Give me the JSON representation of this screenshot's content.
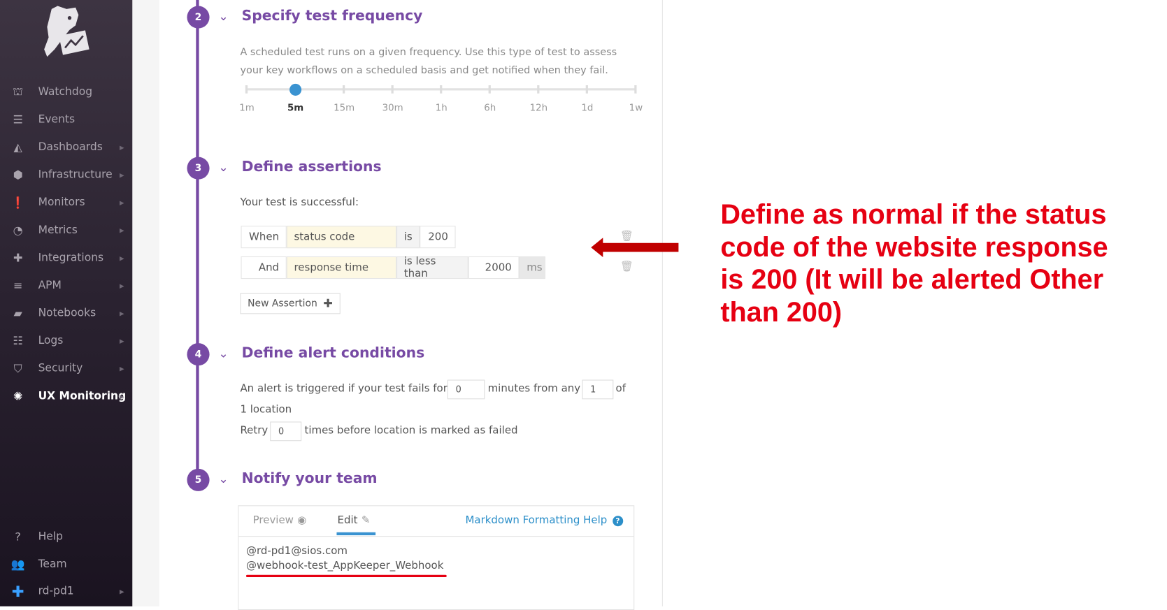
{
  "sidebar": {
    "items": [
      {
        "label": "Watchdog",
        "icon": "binoculars-icon",
        "glyph": "⛫",
        "arrow": false
      },
      {
        "label": "Events",
        "icon": "events-list-icon",
        "glyph": "☰",
        "arrow": false
      },
      {
        "label": "Dashboards",
        "icon": "area-chart-icon",
        "glyph": "◭",
        "arrow": true
      },
      {
        "label": "Infrastructure",
        "icon": "hexagons-icon",
        "glyph": "⬢",
        "arrow": true
      },
      {
        "label": "Monitors",
        "icon": "alert-icon",
        "glyph": "❗",
        "arrow": true
      },
      {
        "label": "Metrics",
        "icon": "gauge-icon",
        "glyph": "◔",
        "arrow": true
      },
      {
        "label": "Integrations",
        "icon": "puzzle-icon",
        "glyph": "✚",
        "arrow": true
      },
      {
        "label": "APM",
        "icon": "apm-icon",
        "glyph": "≡",
        "arrow": true
      },
      {
        "label": "Notebooks",
        "icon": "notebook-icon",
        "glyph": "▰",
        "arrow": true
      },
      {
        "label": "Logs",
        "icon": "logs-icon",
        "glyph": "☷",
        "arrow": true
      },
      {
        "label": "Security",
        "icon": "shield-icon",
        "glyph": "⛉",
        "arrow": true
      },
      {
        "label": "UX Monitoring",
        "icon": "ux-globe-icon",
        "glyph": "✺",
        "arrow": true,
        "active": true
      }
    ],
    "bottom": [
      {
        "label": "Help",
        "icon": "help-icon",
        "glyph": "?"
      },
      {
        "label": "Team",
        "icon": "team-icon",
        "glyph": "👥"
      },
      {
        "label": "rd-pd1",
        "icon": "org-avatar-icon",
        "glyph": "✚"
      }
    ]
  },
  "steps": {
    "s2": {
      "num": "2",
      "title": "Specify test frequency",
      "desc1": "A scheduled test runs on a given frequency. Use this type of test to assess",
      "desc2": "your key workflows on a scheduled basis and get notified when they fail.",
      "ticks": [
        "1m",
        "5m",
        "15m",
        "30m",
        "1h",
        "6h",
        "12h",
        "1d",
        "1w"
      ],
      "selected": "5m"
    },
    "s3": {
      "num": "3",
      "title": "Define assertions",
      "intro": "Your test is successful:",
      "rows": [
        {
          "prefix": "When",
          "field": "status code",
          "op": "is",
          "value": "200",
          "unit": ""
        },
        {
          "prefix": "And",
          "field": "response time",
          "op": "is less than",
          "value": "2000",
          "unit": "ms"
        }
      ],
      "new_assertion": "New Assertion"
    },
    "s4": {
      "num": "4",
      "title": "Define alert conditions",
      "t1": "An alert is triggered if your test fails for",
      "minutes": "0",
      "t2": "minutes from any",
      "locations": "1",
      "t3": "of",
      "t4": "1 location",
      "retry_label": "Retry",
      "retry": "0",
      "t5": "times before location is marked as failed"
    },
    "s5": {
      "num": "5",
      "title": "Notify your team",
      "tab_preview": "Preview",
      "tab_edit": "Edit",
      "help": "Markdown Formatting Help",
      "line1": "@rd-pd1@sios.com",
      "line2": "@webhook-test_AppKeeper_Webhook"
    }
  },
  "annotation": {
    "lines": [
      "Define as normal if the status",
      "code of the website response",
      "is 200 (It will be alerted Other",
      "than 200)"
    ],
    "color": "#e60012"
  },
  "colors": {
    "accent": "#774aa4",
    "slider": "#3a93d1",
    "link": "#2c8fc9"
  }
}
